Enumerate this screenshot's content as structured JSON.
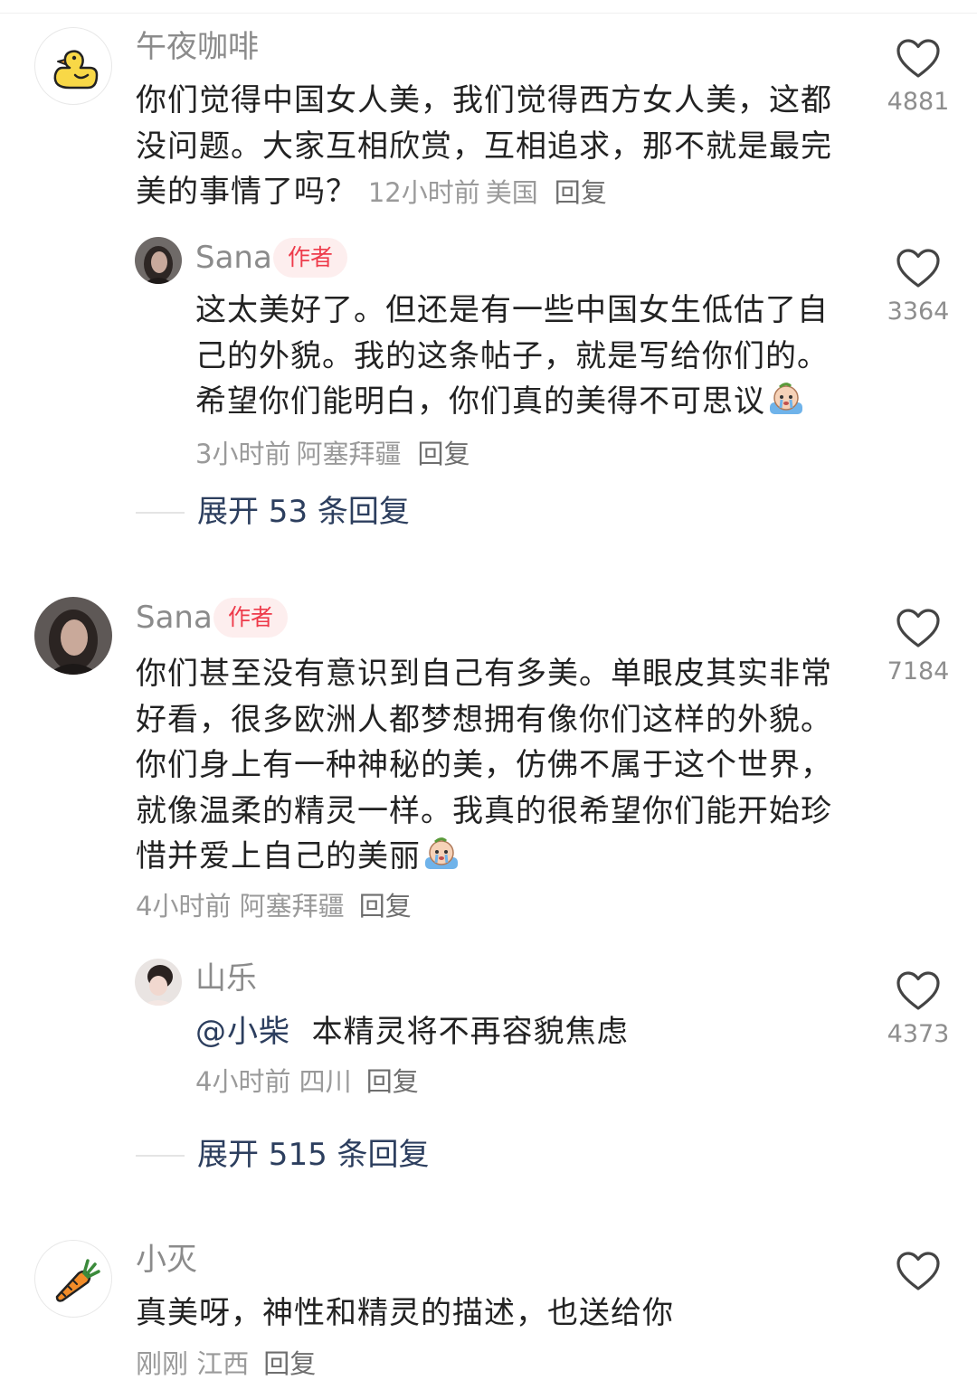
{
  "comments": [
    {
      "user": "午夜咖啡",
      "text": "你们觉得中国女人美，我们觉得西方女人美，这都没问题。大家互相欣赏，互相追求，那不就是最完美的事情了吗？",
      "time": "12小时前",
      "location": "美国",
      "reply_label": "回复",
      "likes": "4881",
      "avatar_icon": "duck-icon",
      "replies": [
        {
          "user": "Sana",
          "badge": "作者",
          "text": "这太美好了。但还是有一些中国女生低估了自己的外貌。我的这条帖子，就是写给你们的。希望你们能明白，你们真的美得不可思议",
          "time": "3小时前",
          "location": "阿塞拜疆",
          "reply_label": "回复",
          "likes": "3364"
        }
      ],
      "expand_label": "展开 53 条回复"
    },
    {
      "user": "Sana",
      "badge": "作者",
      "text": "你们甚至没有意识到自己有多美。单眼皮其实非常好看，很多欧洲人都梦想拥有像你们这样的外貌。你们身上有一种神秘的美，仿佛不属于这个世界，就像温柔的精灵一样。我真的很希望你们能开始珍惜并爱上自己的美丽",
      "time": "4小时前",
      "location": "阿塞拜疆",
      "reply_label": "回复",
      "likes": "7184",
      "replies": [
        {
          "user": "山乐",
          "mention": "@小柴",
          "text": "本精灵将不再容貌焦虑",
          "time": "4小时前",
          "location": "四川",
          "reply_label": "回复",
          "likes": "4373"
        }
      ],
      "expand_label": "展开 515 条回复"
    },
    {
      "user": "小灭",
      "text": "真美呀，神性和精灵的描述，也送给你",
      "time": "刚刚",
      "location": "江西",
      "reply_label": "回复",
      "avatar_icon": "carrot-icon"
    }
  ],
  "colors": {
    "badge_bg": "#fdeeee",
    "badge_text": "#ee3b4b",
    "link": "#2c3e5e",
    "meta": "#9a9a9a"
  }
}
